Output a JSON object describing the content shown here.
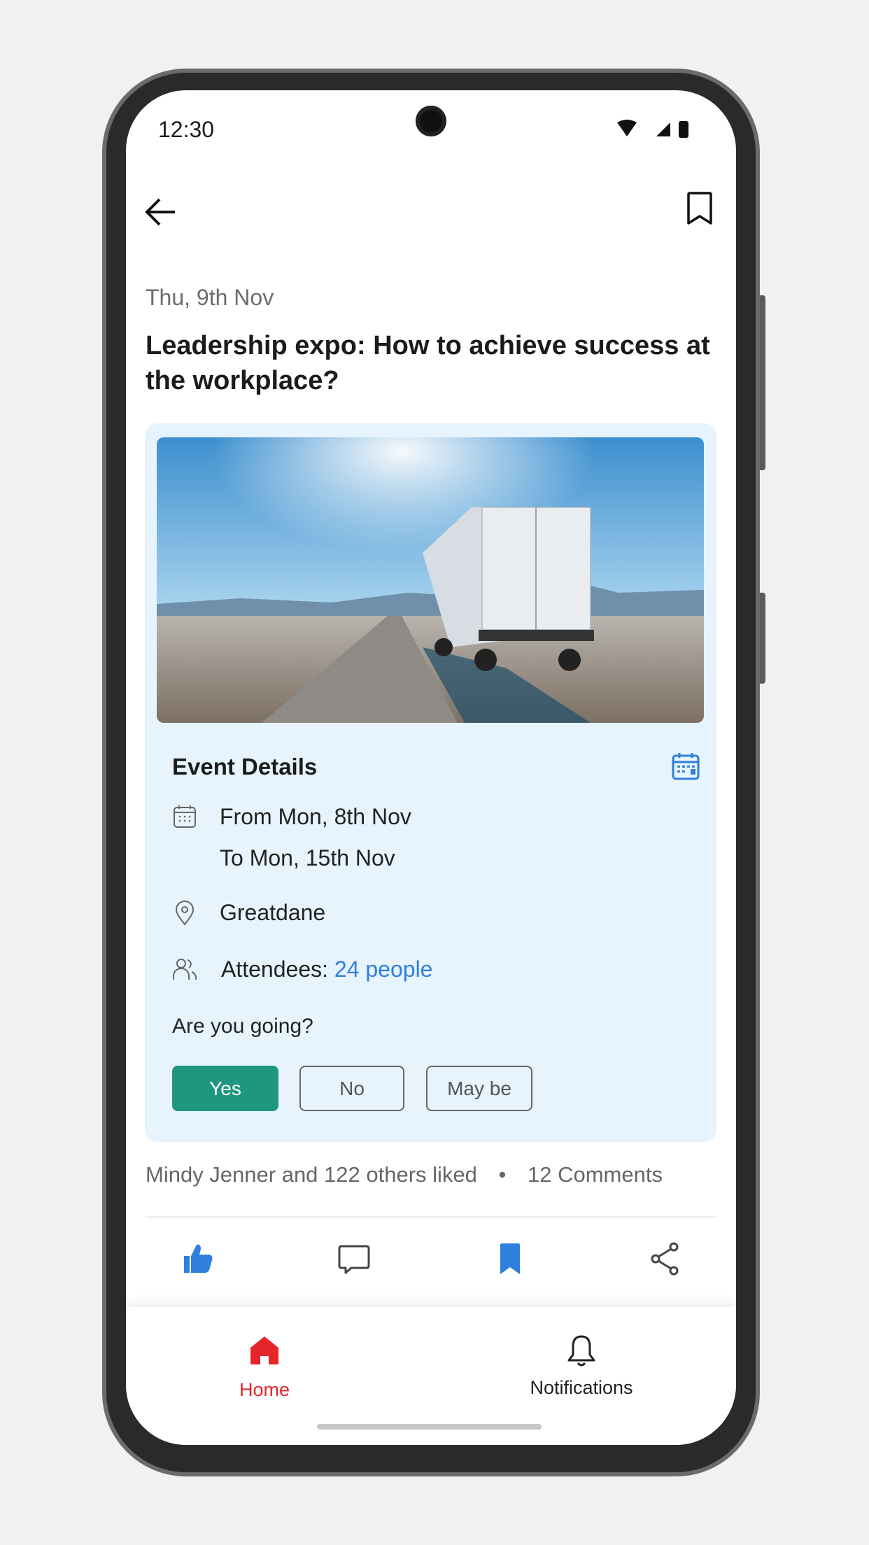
{
  "status_bar": {
    "time": "12:30"
  },
  "header": {
    "back_icon": "arrow-left-icon",
    "bookmark_icon": "bookmark-outline-icon"
  },
  "post": {
    "date": "Thu, 9th Nov",
    "title": "Leadership expo: How to achieve success at the workplace?"
  },
  "event": {
    "heading": "Event Details",
    "from": "From Mon, 8th Nov",
    "to": "To Mon, 15th Nov",
    "location": "Greatdane",
    "attendees_label": "Attendees: ",
    "attendees_value": "24 people",
    "rsvp_question": "Are you going?",
    "rsvp_options": [
      "Yes",
      "No",
      "May be"
    ],
    "rsvp_selected": "Yes"
  },
  "engagement": {
    "likes_text": "Mindy Jenner and 122 others liked",
    "separator": "•",
    "comments_text": "12 Comments"
  },
  "bottom_nav": {
    "items": [
      {
        "label": "Home",
        "active": true
      },
      {
        "label": "Notifications",
        "active": false
      }
    ]
  },
  "colors": {
    "accent_blue": "#2f7fdc",
    "rsvp_green": "#1f9780",
    "home_red": "#e4262b",
    "card_bg": "#e7f4fd"
  }
}
